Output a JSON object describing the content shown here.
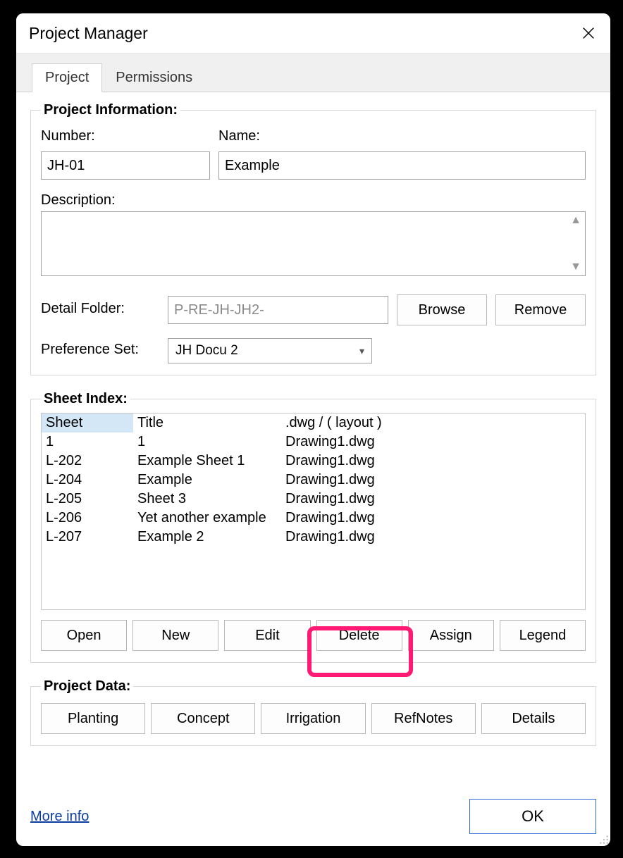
{
  "window": {
    "title": "Project Manager"
  },
  "tabs": {
    "project": "Project",
    "permissions": "Permissions"
  },
  "projectInfo": {
    "legend": "Project Information:",
    "numberLabel": "Number:",
    "numberValue": "JH-01",
    "nameLabel": "Name:",
    "nameValue": "Example",
    "descriptionLabel": "Description:",
    "descriptionValue": "",
    "detailFolderLabel": "Detail Folder:",
    "detailFolderValue": "P-RE-JH-JH2-",
    "browse": "Browse",
    "remove": "Remove",
    "preferenceSetLabel": "Preference Set:",
    "preferenceSetValue": "JH Docu 2"
  },
  "sheetIndex": {
    "legend": "Sheet Index:",
    "columns": {
      "sheet": "Sheet",
      "title": "Title",
      "dwg": ".dwg / ( layout )"
    },
    "rows": [
      {
        "sheet": "1",
        "title": "1",
        "dwg": "Drawing1.dwg"
      },
      {
        "sheet": "L-202",
        "title": "Example Sheet 1",
        "dwg": "Drawing1.dwg"
      },
      {
        "sheet": "L-204",
        "title": "Example",
        "dwg": "Drawing1.dwg"
      },
      {
        "sheet": "L-205",
        "title": "Sheet 3",
        "dwg": "Drawing1.dwg"
      },
      {
        "sheet": "L-206",
        "title": "Yet another example",
        "dwg": "Drawing1.dwg"
      },
      {
        "sheet": "L-207",
        "title": "Example 2",
        "dwg": "Drawing1.dwg"
      }
    ],
    "buttons": {
      "open": "Open",
      "new": "New",
      "edit": "Edit",
      "delete": "Delete",
      "assign": "Assign",
      "legend": "Legend"
    }
  },
  "projectData": {
    "legend": "Project Data:",
    "buttons": {
      "planting": "Planting",
      "concept": "Concept",
      "irrigation": "Irrigation",
      "refnotes": "RefNotes",
      "details": "Details"
    }
  },
  "footer": {
    "moreInfo": "More info",
    "ok": "OK"
  }
}
